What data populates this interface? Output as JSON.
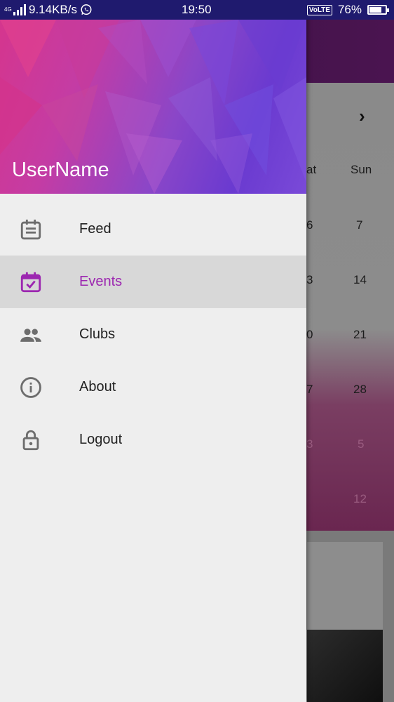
{
  "status_bar": {
    "network": "4G",
    "speed": "9.14KB/s",
    "time": "19:50",
    "volte": "VoLTE",
    "battery": "76%",
    "battery_level": 0.76
  },
  "drawer": {
    "username": "UserName",
    "items": [
      {
        "label": "Feed",
        "icon": "feed-icon",
        "active": false
      },
      {
        "label": "Events",
        "icon": "event-available-icon",
        "active": true
      },
      {
        "label": "Clubs",
        "icon": "people-icon",
        "active": false
      },
      {
        "label": "About",
        "icon": "info-icon",
        "active": false
      },
      {
        "label": "Logout",
        "icon": "lock-icon",
        "active": false
      }
    ],
    "accent_color": "#9c27b0"
  },
  "background_calendar": {
    "headers": [
      "Sat",
      "Sun"
    ],
    "header_visible": [
      "at",
      "Sun"
    ],
    "rows": [
      [
        "6",
        "7"
      ],
      [
        "3",
        "14"
      ],
      [
        "0",
        "21"
      ],
      [
        "7",
        "28"
      ],
      [
        "3",
        "5"
      ],
      [
        "",
        "12"
      ]
    ]
  }
}
